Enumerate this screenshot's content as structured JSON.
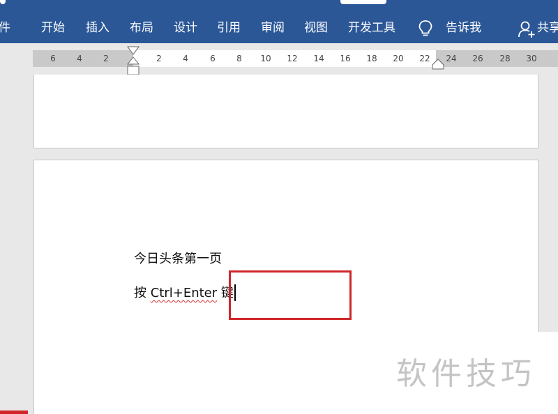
{
  "ribbon": {
    "tabs": [
      {
        "id": "file",
        "label": "件"
      },
      {
        "id": "home",
        "label": "开始"
      },
      {
        "id": "insert",
        "label": "插入"
      },
      {
        "id": "layout",
        "label": "布局"
      },
      {
        "id": "design",
        "label": "设计"
      },
      {
        "id": "references",
        "label": "引用"
      },
      {
        "id": "review",
        "label": "审阅"
      },
      {
        "id": "view",
        "label": "视图"
      },
      {
        "id": "developer",
        "label": "开发工具"
      }
    ],
    "tell_me": "告诉我",
    "share": "共享"
  },
  "ruler": {
    "ticks": [
      "6",
      "4",
      "2",
      "2",
      "4",
      "6",
      "8",
      "10",
      "12",
      "14",
      "16",
      "18",
      "20",
      "22",
      "24",
      "26",
      "28",
      "30"
    ]
  },
  "document": {
    "line1": "今日头条第一页",
    "line2_prefix": "按 ",
    "line2_flagged": "Ctrl+Enter",
    "line2_suffix": " 键"
  },
  "watermark": "软件技巧",
  "colors": {
    "ribbon": "#2b5797",
    "highlight": "#d0262a",
    "spell_squiggle": "#d32f2f"
  }
}
